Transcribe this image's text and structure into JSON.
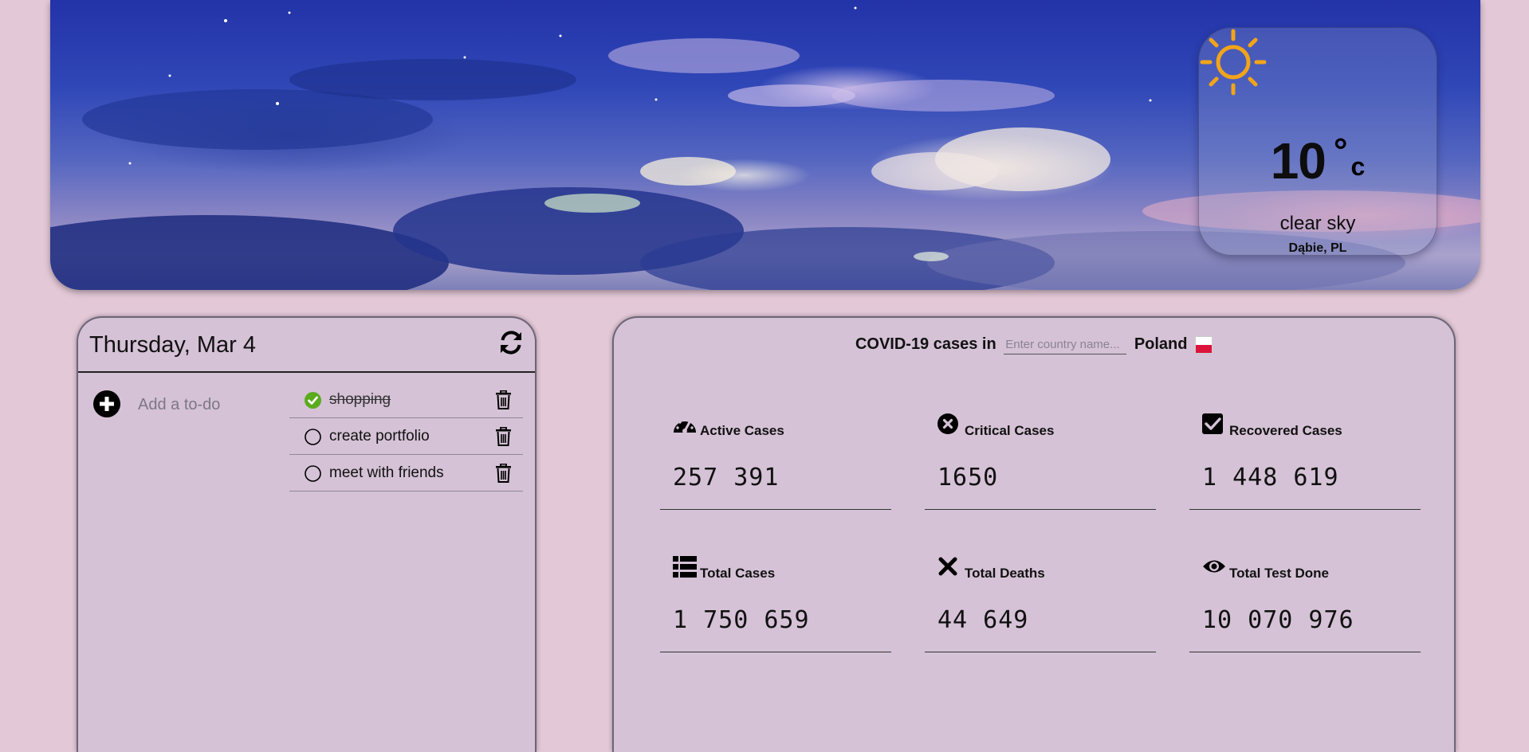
{
  "weather": {
    "temp": "10",
    "degree": "°",
    "unit": "c",
    "description": "clear sky",
    "location": "Dąbie, PL",
    "icon": "sun-icon"
  },
  "todo": {
    "date": "Thursday, Mar 4",
    "input_placeholder": "Add a to-do",
    "items": [
      {
        "text": "shopping",
        "done": true
      },
      {
        "text": "create portfolio",
        "done": false
      },
      {
        "text": "meet with friends",
        "done": false
      }
    ]
  },
  "covid": {
    "title_prefix": "COVID-19 cases in",
    "input_placeholder": "Enter country name...",
    "country": "Poland",
    "stats": [
      {
        "label": "Active Cases",
        "value": "257 391",
        "icon": "dashboard-icon"
      },
      {
        "label": "Critical Cases",
        "value": "1650",
        "icon": "circle-x-icon"
      },
      {
        "label": "Recovered Cases",
        "value": "1 448 619",
        "icon": "checkbox-icon"
      },
      {
        "label": "Total Cases",
        "value": "1 750 659",
        "icon": "list-icon"
      },
      {
        "label": "Total Deaths",
        "value": "44 649",
        "icon": "x-icon"
      },
      {
        "label": "Total Test Done",
        "value": "10 070 976",
        "icon": "eye-icon"
      }
    ]
  },
  "colors": {
    "background": "#e3c8d7",
    "panel": "#d5c2d6",
    "check_done": "#5aab1e",
    "sun": "#f2a419",
    "flag_red": "#dc143c"
  }
}
